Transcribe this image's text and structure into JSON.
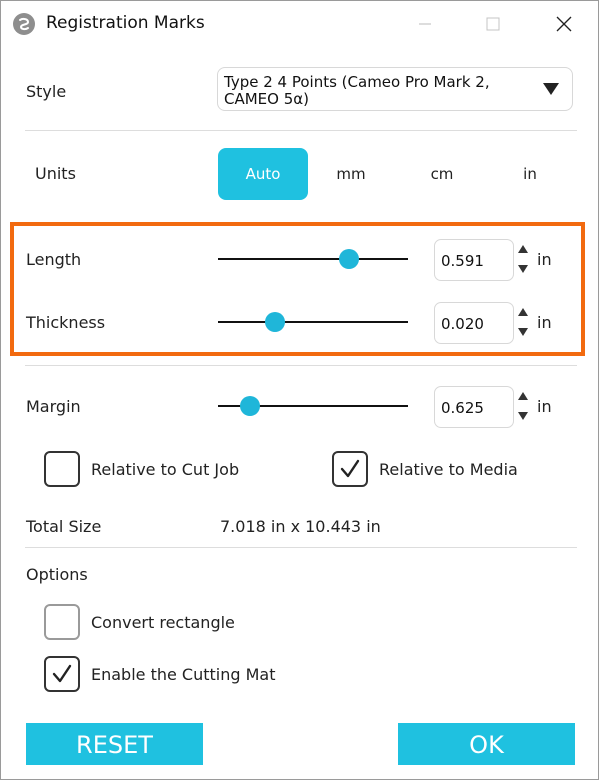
{
  "window": {
    "title": "Registration Marks"
  },
  "style": {
    "label": "Style",
    "selected_value": "Type 2 4 Points (Cameo Pro Mark 2, CAMEO 5α)"
  },
  "units": {
    "label": "Units",
    "options": [
      "Auto",
      "mm",
      "cm",
      "in"
    ],
    "selected": "Auto"
  },
  "length": {
    "label": "Length",
    "value": "0.591",
    "unit": "in",
    "slider_fraction": 0.69
  },
  "thickness": {
    "label": "Thickness",
    "value": "0.020",
    "unit": "in",
    "slider_fraction": 0.3
  },
  "margin": {
    "label": "Margin",
    "value": "0.625",
    "unit": "in",
    "slider_fraction": 0.17
  },
  "relative": {
    "cut_job_label": "Relative to Cut Job",
    "cut_job_checked": false,
    "media_label": "Relative to Media",
    "media_checked": true
  },
  "total_size": {
    "label": "Total Size",
    "value": "7.018 in x 10.443 in"
  },
  "options": {
    "label": "Options",
    "convert_rectangle_label": "Convert rectangle",
    "convert_rectangle_checked": false,
    "enable_cutting_mat_label": "Enable the Cutting Mat",
    "enable_cutting_mat_checked": true
  },
  "buttons": {
    "reset_label": "RESET",
    "ok_label": "OK"
  },
  "colors": {
    "accent": "#1fc1e0",
    "highlight": "#f26a0f",
    "slider_thumb": "#1fb6d9"
  }
}
